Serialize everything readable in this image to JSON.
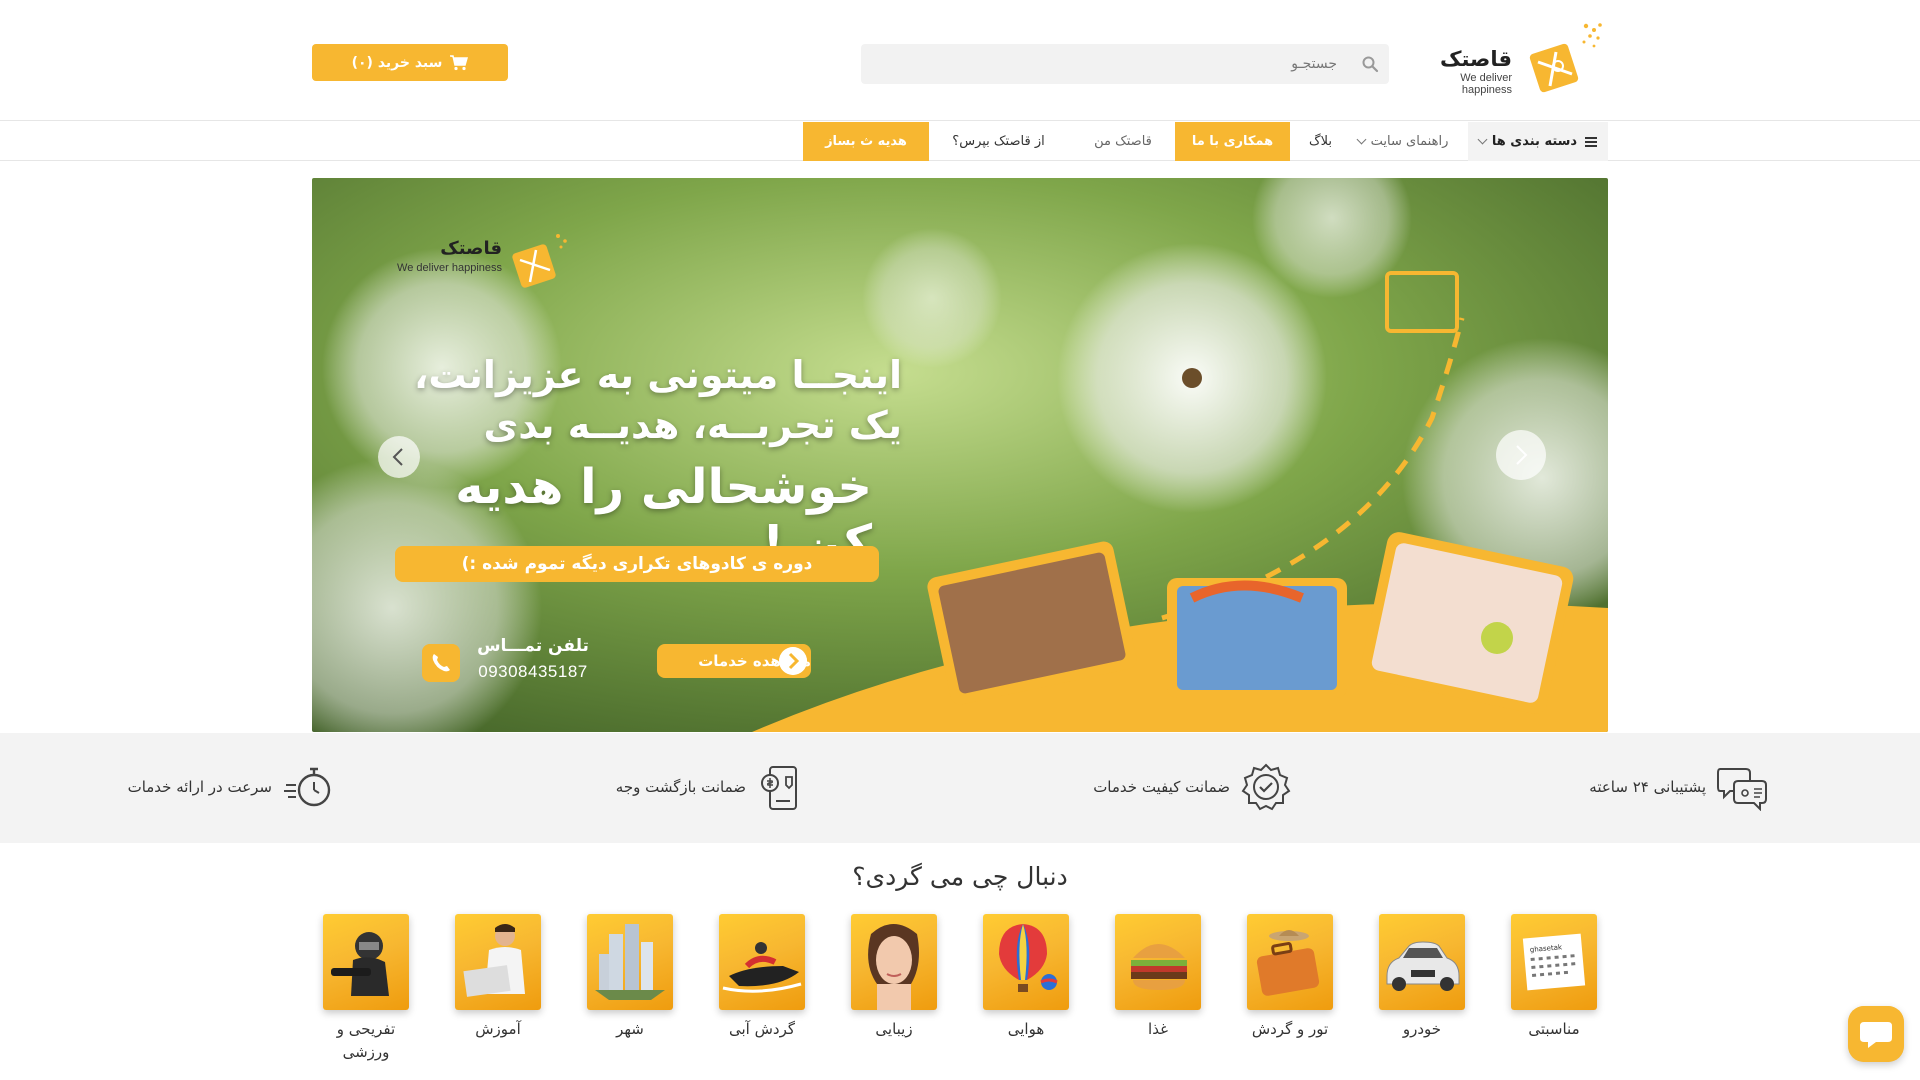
{
  "brand": {
    "name": "قاصتک",
    "tagline": "We deliver happiness"
  },
  "header": {
    "search_placeholder": "جستجـو",
    "cart_label": "سبد خرید (۰)"
  },
  "nav": {
    "categories": "دسته بندی ها",
    "site_guide": "راهنمای سایت",
    "blog": "بلاگ",
    "partner": "همکاری با ما",
    "my_ghastak": "قاصتک من",
    "ask": "از قاصتک بپرس؟",
    "gift": "هدیه ث بساز"
  },
  "hero": {
    "line1": "اینجــا میتونی به عزیزانت،",
    "line2": "یک تجربــه، هدیــه بدی",
    "headline": "خوشحالی را هدیه کن !",
    "pill": "دوره ی کادوهای تکراری دیگه تموم شده :)",
    "phone_label": "تلفن تمـــاس",
    "phone_number": "09308435187",
    "cta": "مشاهده خدمات"
  },
  "features": [
    {
      "label": "پشتیبانی ۲۴ ساعته",
      "icon": "support-chat-icon"
    },
    {
      "label": "ضمانت کیفیت خدمات",
      "icon": "quality-badge-icon"
    },
    {
      "label": "ضمانت بازگشت وجه",
      "icon": "money-back-icon"
    },
    {
      "label": "سرعت در ارائه خدمات",
      "icon": "stopwatch-icon"
    }
  ],
  "categories_title": "دنبال چی می گردی؟",
  "categories": [
    {
      "label": "مناسبتی",
      "icon": "calendar-icon"
    },
    {
      "label": "خودرو",
      "icon": "car-icon"
    },
    {
      "label": "تور و گردش",
      "icon": "suitcase-icon"
    },
    {
      "label": "غذا",
      "icon": "burger-icon"
    },
    {
      "label": "هوایی",
      "icon": "hot-air-balloon-icon"
    },
    {
      "label": "زیبایی",
      "icon": "beauty-face-icon"
    },
    {
      "label": "گردش آبی",
      "icon": "jet-ski-icon"
    },
    {
      "label": "شهر",
      "icon": "city-icon"
    },
    {
      "label": "آموزش",
      "icon": "laptop-student-icon"
    },
    {
      "label": "تفریحی و ورزشی",
      "icon": "paintball-icon"
    }
  ],
  "colors": {
    "accent": "#f7b731",
    "feature_bg": "#f3f3f3"
  }
}
